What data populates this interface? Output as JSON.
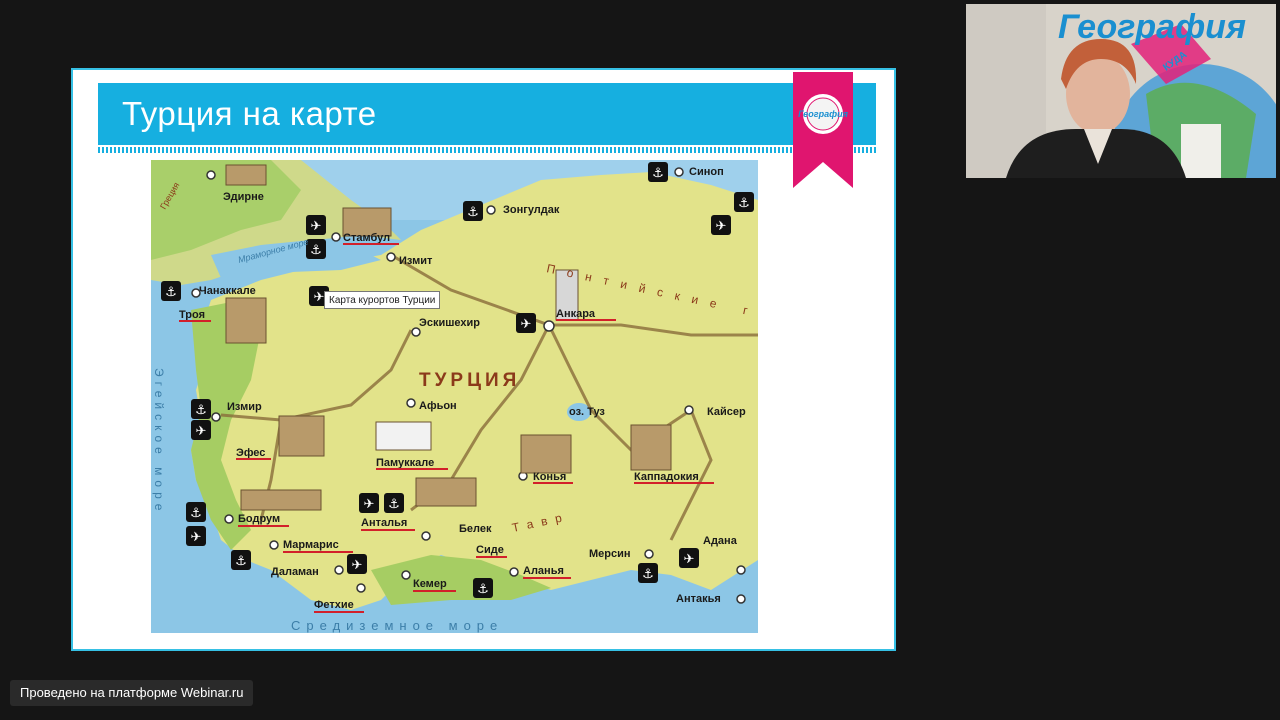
{
  "slide": {
    "title": "Турция на карте",
    "ribbon_logo": "География"
  },
  "map": {
    "tooltip": "Карта курортов Турции",
    "country_label": "ТУРЦИЯ",
    "sea_label": "Средиземное море",
    "aegean_label": "Эгейское море",
    "pontic_label": "Понтийские горы",
    "taurus_label": "Тавр",
    "cities": {
      "edirne": "Эдирне",
      "istanbul": "Стамбул",
      "izmit": "Измит",
      "zonguldak": "Зонгулдак",
      "sinop": "Синоп",
      "chanakkale": "Чанаккале",
      "troya": "Троя",
      "eskisehir": "Эскишехир",
      "ankara": "Анкара",
      "izmir": "Измир",
      "afyon": "Афьон",
      "efes": "Эфес",
      "pamukkale": "Памуккале",
      "konya": "Конья",
      "kayseri": "Кайсер",
      "kappadokia": "Каппадокия",
      "bodrum": "Бодрум",
      "marmaris": "Мармарис",
      "dalaman": "Даламан",
      "fethiye": "Фетхие",
      "kemer": "Кемер",
      "antalya": "Анталья",
      "belek": "Белек",
      "side": "Сиде",
      "alanya": "Аланья",
      "mersin": "Мерсин",
      "adana": "Адана",
      "antakya": "Антакья",
      "tuz": "оз. Туз",
      "grecia": "Греция",
      "marmara": "Мраморное море"
    }
  },
  "webcam": {
    "brand": "География",
    "sub": "КУДА"
  },
  "footer": {
    "platform": "Проведено на платформе Webinar.ru"
  },
  "colors": {
    "header": "#16afe0",
    "ribbon": "#e0156f",
    "land": "#e2e38a",
    "sea": "#8cc6e6",
    "underline": "#d2202a"
  }
}
